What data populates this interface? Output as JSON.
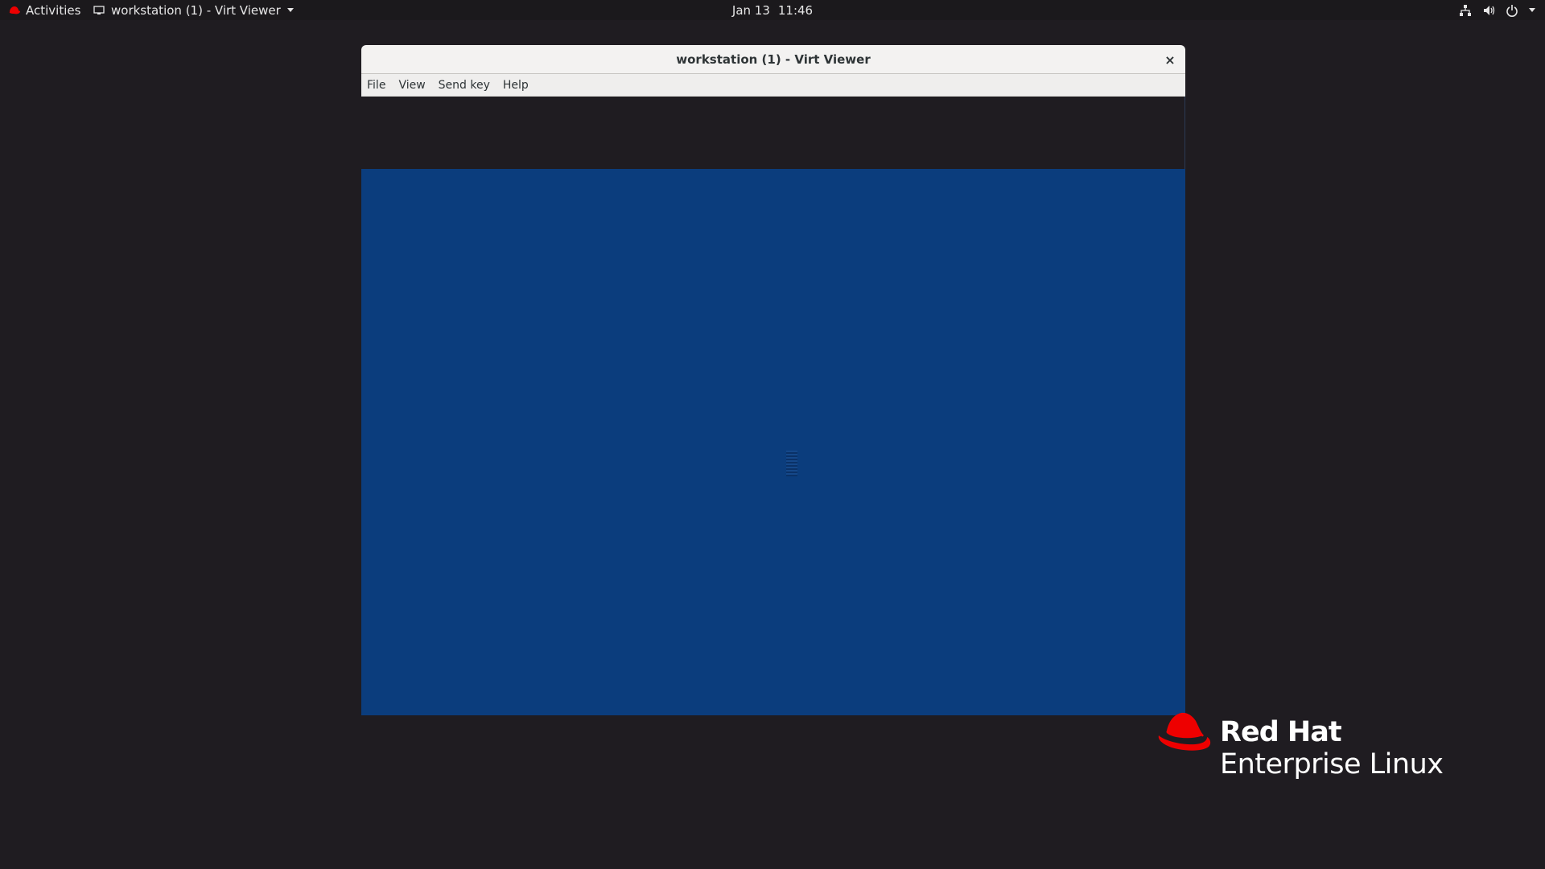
{
  "topbar": {
    "activities_label": "Activities",
    "app_title": "workstation (1) - Virt Viewer",
    "date": "Jan 13",
    "time": "11:46",
    "icons": [
      "network-icon",
      "volume-icon",
      "power-icon"
    ]
  },
  "window": {
    "title": "workstation (1) - Virt Viewer",
    "close_glyph": "×",
    "menu": [
      "File",
      "View",
      "Send key",
      "Help"
    ]
  },
  "guest": {
    "background_color": "#0b3d7d"
  },
  "brand": {
    "line1": "Red Hat",
    "line2": "Enterprise Linux",
    "hat_color": "#ee0000"
  }
}
